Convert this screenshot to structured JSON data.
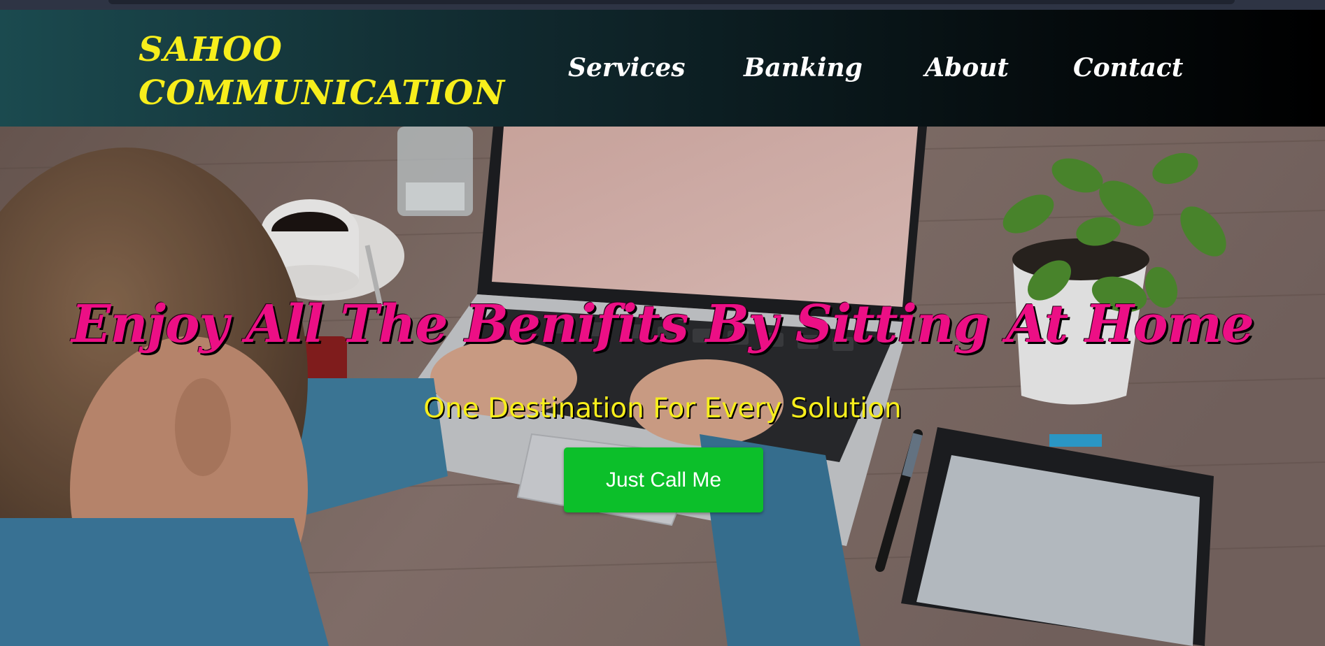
{
  "brand": {
    "line1": "SAHOO",
    "line2": "COMMUNICATION",
    "color": "#f7ee1c"
  },
  "nav": {
    "items": [
      {
        "label": "Services"
      },
      {
        "label": "Banking"
      },
      {
        "label": "About"
      },
      {
        "label": "Contact"
      }
    ]
  },
  "hero": {
    "headline": "Enjoy All The Benifits By Sitting At Home",
    "headline_color": "#ec0f85",
    "subtitle": "One Destination For Every Solution",
    "subtitle_color": "#f7ee1c",
    "cta_label": "Just Call Me",
    "cta_color": "#0cbf2a",
    "background_image": "photo of a person typing on a laptop at a wooden desk with coffee cup, water glass, potted plant, pen and drawing tablet"
  }
}
